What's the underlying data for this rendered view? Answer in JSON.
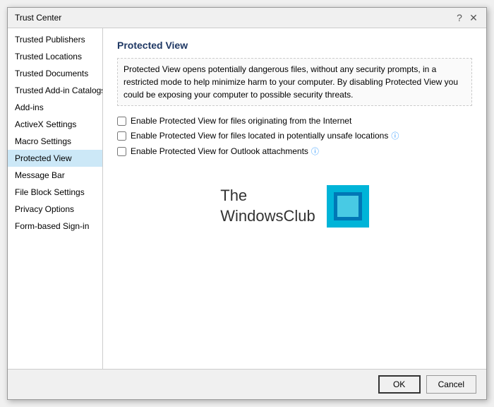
{
  "window": {
    "title": "Trust Center",
    "help_icon": "?",
    "close_icon": "✕"
  },
  "sidebar": {
    "items": [
      {
        "id": "trusted-publishers",
        "label": "Trusted Publishers",
        "active": false
      },
      {
        "id": "trusted-locations",
        "label": "Trusted Locations",
        "active": false
      },
      {
        "id": "trusted-documents",
        "label": "Trusted Documents",
        "active": false
      },
      {
        "id": "trusted-add-in-catalogs",
        "label": "Trusted Add-in Catalogs",
        "active": false
      },
      {
        "id": "add-ins",
        "label": "Add-ins",
        "active": false
      },
      {
        "id": "activex-settings",
        "label": "ActiveX Settings",
        "active": false
      },
      {
        "id": "macro-settings",
        "label": "Macro Settings",
        "active": false
      },
      {
        "id": "protected-view",
        "label": "Protected View",
        "active": true
      },
      {
        "id": "message-bar",
        "label": "Message Bar",
        "active": false
      },
      {
        "id": "file-block-settings",
        "label": "File Block Settings",
        "active": false
      },
      {
        "id": "privacy-options",
        "label": "Privacy Options",
        "active": false
      },
      {
        "id": "form-based-sign-in",
        "label": "Form-based Sign-in",
        "active": false
      }
    ]
  },
  "content": {
    "title": "Protected View",
    "description": "Protected View opens potentially dangerous files, without any security prompts, in a restricted mode to help minimize harm to your computer. By disabling Protected View you could be exposing your computer to possible security threats.",
    "checkboxes": [
      {
        "id": "chk-internet",
        "label": "Enable Protected View for files originating from the Internet",
        "checked": false,
        "has_info": false
      },
      {
        "id": "chk-unsafe",
        "label": "Enable Protected View for files located in potentially unsafe locations",
        "checked": false,
        "has_info": true
      },
      {
        "id": "chk-outlook",
        "label": "Enable Protected View for Outlook attachments",
        "checked": false,
        "has_info": true
      }
    ],
    "watermark": {
      "line1": "The",
      "line2": "WindowsClub"
    }
  },
  "footer": {
    "ok_label": "OK",
    "cancel_label": "Cancel"
  }
}
